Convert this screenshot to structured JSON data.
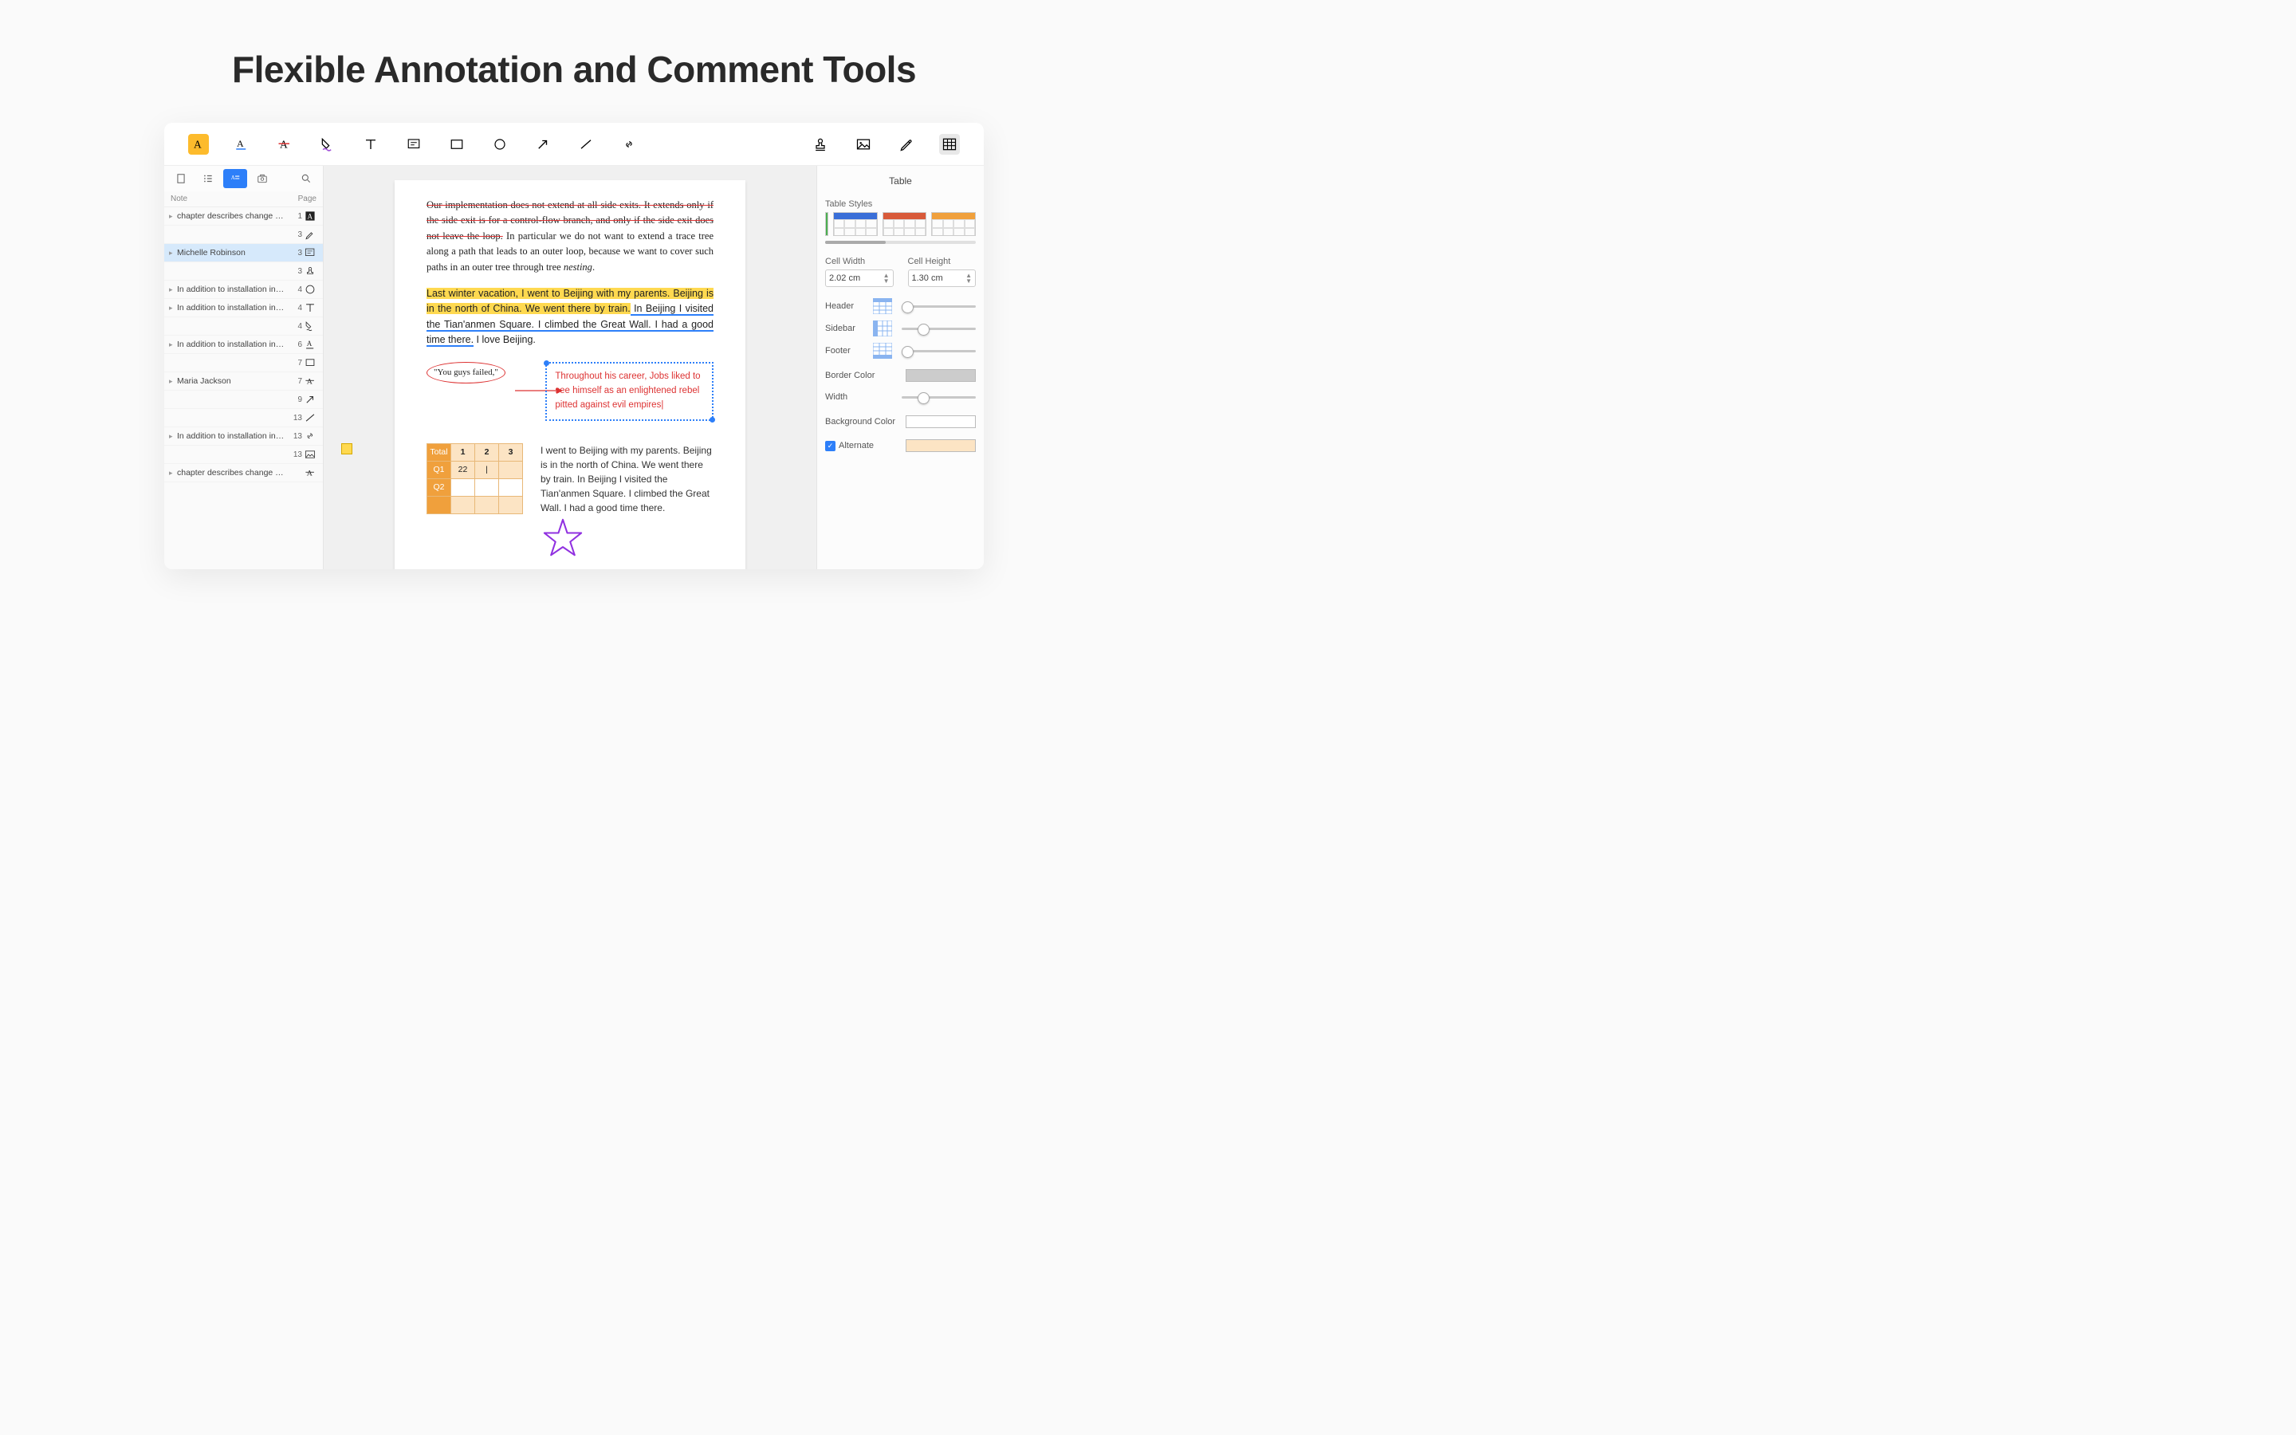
{
  "hero": {
    "title": "Flexible Annotation and Comment Tools"
  },
  "toolbar": {
    "tools": [
      "highlight",
      "underline",
      "strikethrough",
      "squiggle",
      "text",
      "note",
      "rectangle",
      "circle",
      "arrow",
      "line",
      "link"
    ],
    "right_tools": [
      "stamp",
      "image",
      "signature",
      "table"
    ]
  },
  "left_panel": {
    "header_note": "Note",
    "header_page": "Page",
    "rows": [
      {
        "text": "chapter describes change Sho…",
        "page": "1",
        "icon": "highlight-icon",
        "arrow": true
      },
      {
        "text": "",
        "page": "3",
        "icon": "sign-icon",
        "arrow": false
      },
      {
        "text": "Michelle Robinson",
        "page": "3",
        "icon": "note-icon",
        "arrow": true,
        "sel": true
      },
      {
        "text": "",
        "page": "3",
        "icon": "stamp-icon",
        "arrow": false
      },
      {
        "text": "In addition to installation instru…",
        "page": "4",
        "icon": "circle-icon",
        "arrow": true
      },
      {
        "text": "In addition to installation instru…",
        "page": "4",
        "icon": "text-icon",
        "arrow": true
      },
      {
        "text": "",
        "page": "4",
        "icon": "squiggle-icon",
        "arrow": false
      },
      {
        "text": "In addition to installation instru…",
        "page": "6",
        "icon": "underline-icon",
        "arrow": true
      },
      {
        "text": "",
        "page": "7",
        "icon": "rect-icon",
        "arrow": false
      },
      {
        "text": "Maria Jackson",
        "page": "7",
        "icon": "strike-icon",
        "arrow": true
      },
      {
        "text": "",
        "page": "9",
        "icon": "arrow-icon",
        "arrow": false
      },
      {
        "text": "",
        "page": "13",
        "icon": "line-icon",
        "arrow": false
      },
      {
        "text": "In addition to installation instru…",
        "page": "13",
        "icon": "link-icon",
        "arrow": true
      },
      {
        "text": "",
        "page": "13",
        "icon": "image-icon",
        "arrow": false
      },
      {
        "text": "chapter describes change Sho…",
        "page": "",
        "icon": "strike-icon",
        "arrow": true
      }
    ]
  },
  "document": {
    "para1_strike": "Our implementation does not extend at all side exits. It extends only if the side exit is for a control-flow branch, and only if the side exit does not leave the loop.",
    "para1_rest": " In particular we do not want to extend a trace tree along a path that leads to an outer loop, because we want to cover such paths in an outer tree through tree ",
    "para1_italic": "nesting",
    "para1_end": ".",
    "para2_hl": "Last winter vacation, I went to Beijing with my parents. Beijing is in the north of China. We went there by train.",
    "para2_ul": " In Beijing I visited the Tian'anmen Square. I climbed the Great Wall. I had a good time there.",
    "para2_rest": " I love Beijing.",
    "oval_text": "\"You guys failed,\"",
    "textbox_text": "Throughout his career, Jobs liked to see himself as an enlightened rebel pitted against evil empires",
    "chart_data": {
      "type": "table",
      "headers": [
        "Total",
        "1",
        "2",
        "3"
      ],
      "rows": [
        {
          "label": "Q1",
          "cells": [
            "22",
            "|",
            ""
          ]
        },
        {
          "label": "Q2",
          "cells": [
            "",
            "",
            ""
          ]
        },
        {
          "label": "",
          "cells": [
            "",
            "",
            ""
          ]
        }
      ]
    },
    "para3": "I went to Beijing with my parents. Beijing is in the north of China. We went there by train. In Beijing I visited the Tian'anmen Square. I climbed the Great Wall. I had a good time there."
  },
  "right_panel": {
    "title": "Table",
    "styles_label": "Table Styles",
    "cell_width_label": "Cell Width",
    "cell_width_value": "2.02 cm",
    "cell_height_label": "Cell Height",
    "cell_height_value": "1.30 cm",
    "header_label": "Header",
    "sidebar_label": "Sidebar",
    "footer_label": "Footer",
    "border_color_label": "Border Color",
    "width_label": "Width",
    "background_label": "Background Color",
    "alternate_label": "Alternate",
    "style_colors": [
      "#3a6fd8",
      "#d85a3a",
      "#f0a03c"
    ]
  }
}
